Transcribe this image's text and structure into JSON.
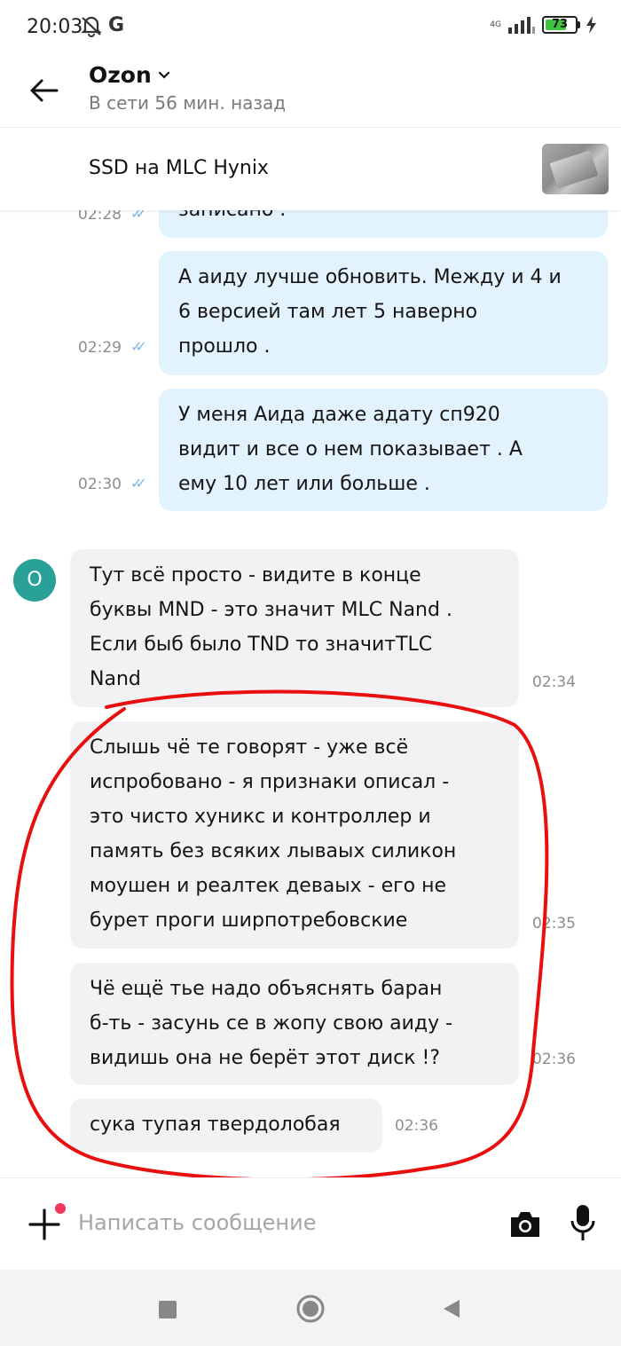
{
  "status_bar": {
    "time": "20:03",
    "network_label": "4G",
    "battery_level": "73",
    "battery_fraction": 0.73
  },
  "header": {
    "title": "Ozon",
    "status": "В сети 56 мин. назад"
  },
  "product": {
    "name": "SSD на MLC Hynix"
  },
  "messages": [
    {
      "dir": "out",
      "lines": [
        "записано ."
      ],
      "time": "02:28"
    },
    {
      "dir": "out",
      "lines": [
        "А аиду лучше обновить. Между и 4 и",
        "6 версией там лет 5 наверно",
        "прошло ."
      ],
      "time": "02:29"
    },
    {
      "dir": "out",
      "lines": [
        "У меня Аида даже адату сп920",
        "видит и все о нем показывает . А",
        "ему 10 лет или больше ."
      ],
      "time": "02:30"
    },
    {
      "dir": "in",
      "lines": [
        "Тут всё просто - видите в конце",
        "буквы MND - это значит MLC Nand .",
        "Если быб было TND то значитTLC",
        "Nand"
      ],
      "time": "02:34"
    },
    {
      "dir": "in",
      "lines": [
        "Слышь чё те говорят - уже всё",
        "испробовано - я признаки описал -",
        "это чисто хуникс и контроллер и",
        "память без всяких лываых силикон",
        "моушен и реалтек деваых - его не",
        "бурет проги ширпотребовские"
      ],
      "time": "02:35"
    },
    {
      "dir": "in",
      "lines": [
        "Чё ещё тье надо  объяснять баран",
        "б-ть - засунь се в жопу свою аиду -",
        "видишь она не берёт этот диск !?"
      ],
      "time": "02:36"
    },
    {
      "dir": "in",
      "lines": [
        "сука тупая твердолобая"
      ],
      "time": "02:36"
    }
  ],
  "sender_avatar": "O",
  "composer": {
    "placeholder": "Написать сообщение"
  },
  "icons": {
    "back": "arrow-left-icon",
    "title_dropdown": "chevron-down-icon",
    "attach": "plus-icon",
    "camera": "camera-icon",
    "mic": "microphone-icon",
    "read_receipt": "double-check-icon"
  },
  "colors": {
    "outgoing_bubble": "#e3f3fd",
    "incoming_bubble": "#f2f2f4",
    "avatar": "#2aa198",
    "read_ticks": "#7fb5e6",
    "notification_dot": "#f0365b",
    "annotation_ring": "#e8100f"
  }
}
